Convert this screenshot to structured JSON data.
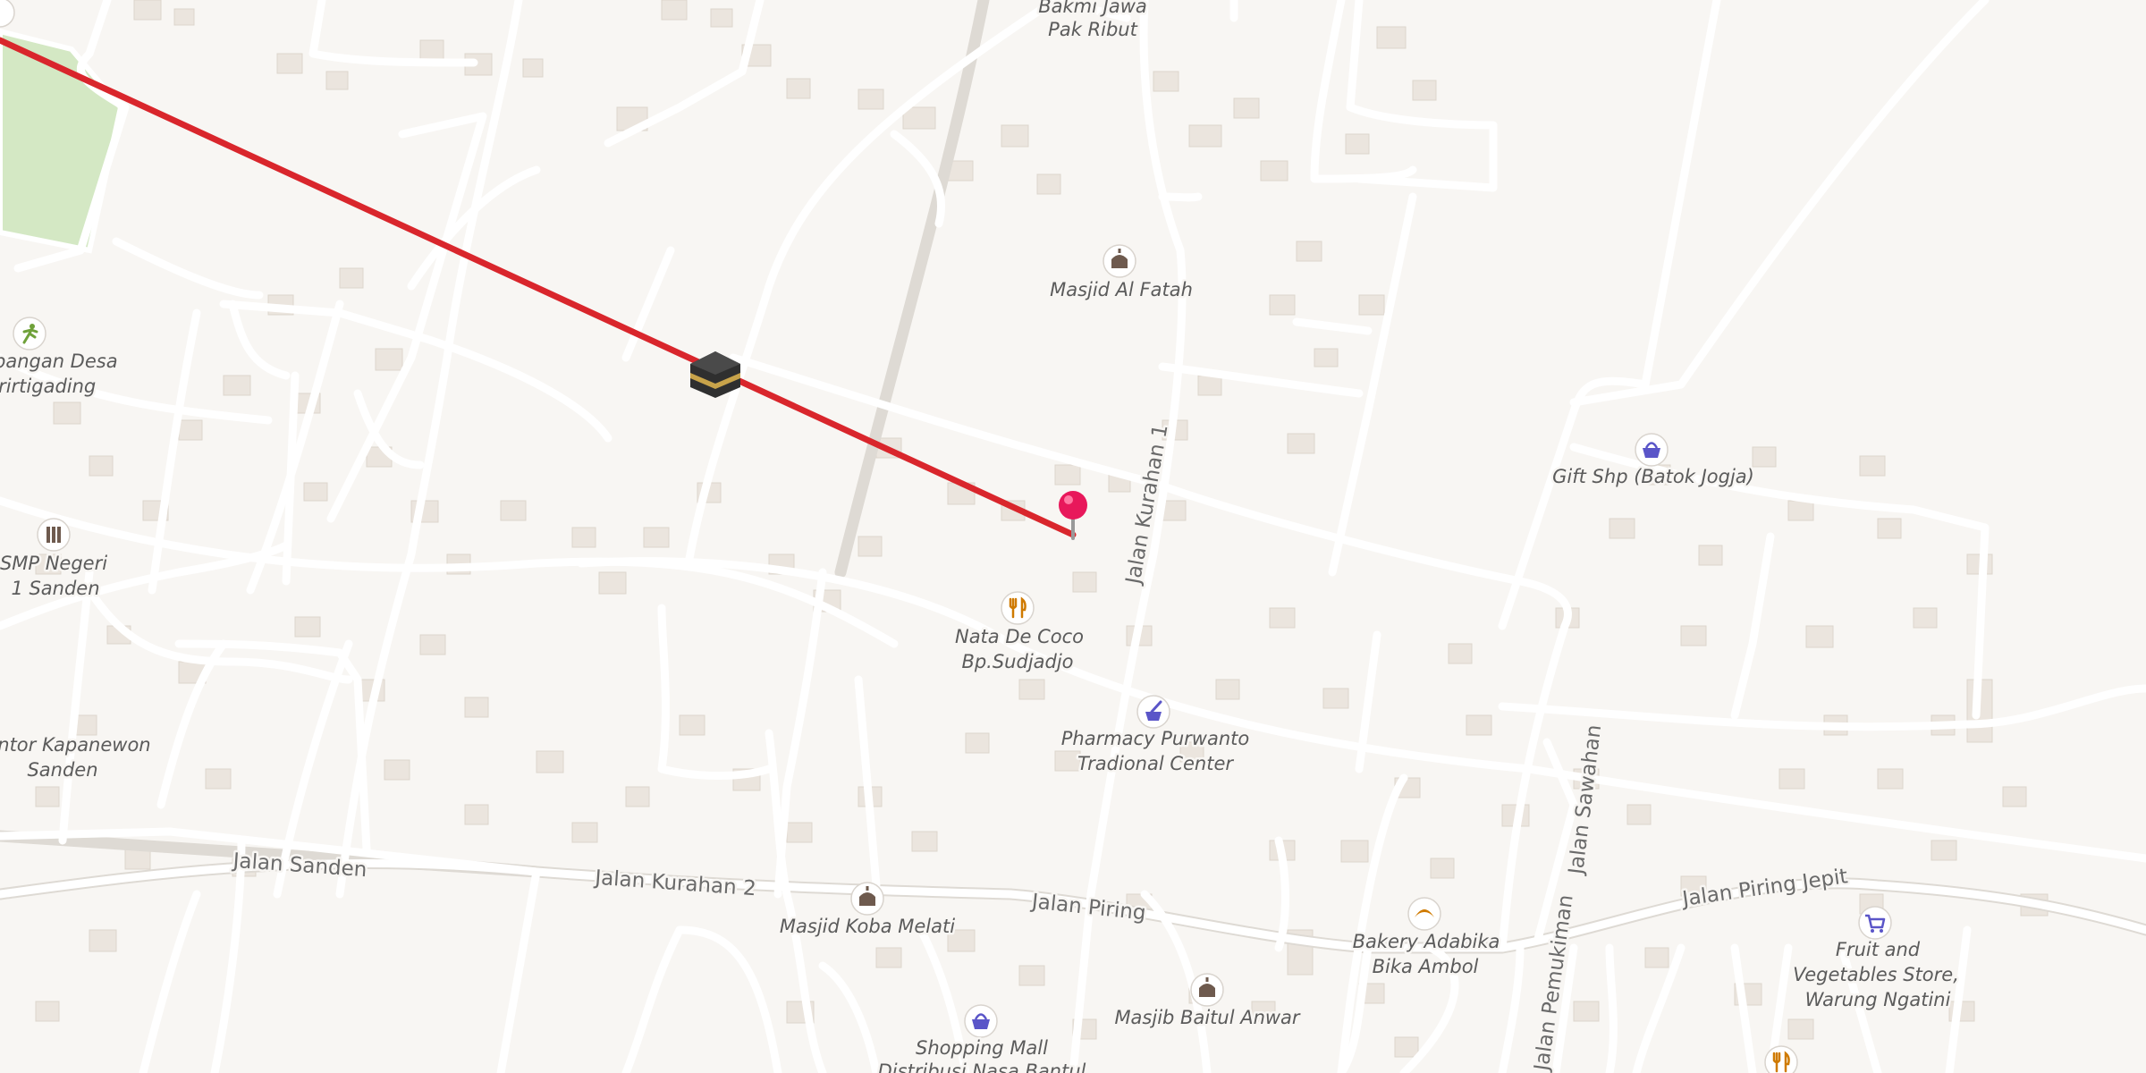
{
  "map": {
    "streets": [
      {
        "id": "jalan-sanden",
        "name": "Jalan Sanden"
      },
      {
        "id": "jalan-kurahan-2",
        "name": "Jalan Kurahan 2"
      },
      {
        "id": "jalan-piring",
        "name": "Jalan Piring"
      },
      {
        "id": "jalan-kurahan-1",
        "name": "Jalan Kurahan 1"
      },
      {
        "id": "jalan-sawahan",
        "name": "Jalan Sawahan"
      },
      {
        "id": "jalan-pemukiman",
        "name": "Jalan Pemukiman"
      },
      {
        "id": "jalan-piring-jepit",
        "name": "Jalan Piring Jepit"
      }
    ],
    "pois": [
      {
        "id": "bakmi-jawa",
        "type": "restaurant",
        "lines": [
          "Bakmi Jawa",
          "Pak Ribut"
        ]
      },
      {
        "id": "masjid-al-fatah",
        "type": "mosque",
        "lines": [
          "Masjid Al Fatah"
        ]
      },
      {
        "id": "lapangan-desa",
        "type": "sports",
        "lines": [
          "Lapangan Desa",
          "Srirtigading"
        ]
      },
      {
        "id": "smp-negeri",
        "type": "school",
        "lines": [
          "SMP Negeri",
          "1 Sanden"
        ]
      },
      {
        "id": "kantor-kapanewon",
        "type": "office",
        "lines": [
          "Kantor Kapanewon",
          "Sanden"
        ]
      },
      {
        "id": "nata-de-coco",
        "type": "restaurant",
        "lines": [
          "Nata De Coco",
          "Bp.Sudjadjo"
        ]
      },
      {
        "id": "pharmacy",
        "type": "pharmacy",
        "lines": [
          "Pharmacy Purwanto",
          "Tradional Center"
        ]
      },
      {
        "id": "gift-shop",
        "type": "shop",
        "lines": [
          "Gift Shp (Batok Jogja)"
        ]
      },
      {
        "id": "masjid-koba-melati",
        "type": "mosque",
        "lines": [
          "Masjid Koba Melati"
        ]
      },
      {
        "id": "bakery",
        "type": "bakery",
        "lines": [
          "Bakery Adabika",
          "Bika Ambol"
        ]
      },
      {
        "id": "masjib-baitul-anwar",
        "type": "mosque",
        "lines": [
          "Masjib Baitul Anwar"
        ]
      },
      {
        "id": "shopping-mall",
        "type": "shop",
        "lines": [
          "Shopping Mall",
          "Distribusi Nasa Bantul"
        ]
      },
      {
        "id": "fruit-store",
        "type": "grocery",
        "lines": [
          "Fruit and",
          "Vegetables Store,",
          "Warung Ngatini"
        ]
      }
    ],
    "qibla_line_color": "#d9262c",
    "pin_color": "#e8185b",
    "park_color": "#d4e8c4",
    "icon_colors": {
      "mosque": "#6e5a4e",
      "restaurant": "#cf7a00",
      "shop": "#5a55c8",
      "pharmacy": "#5a55c8",
      "school": "#6e5a4e",
      "sports": "#6fa13a",
      "bakery": "#cf7a00"
    }
  }
}
